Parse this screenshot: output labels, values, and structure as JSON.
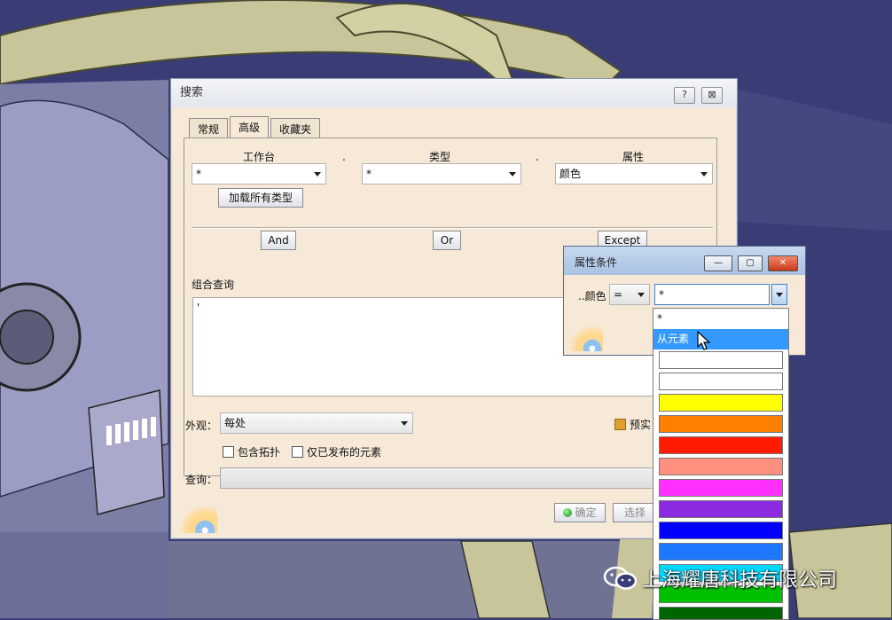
{
  "search_dialog": {
    "title": "搜索",
    "help_btn": "?",
    "close_btn": "⊠",
    "tabs": [
      {
        "label": "常规"
      },
      {
        "label": "高级"
      },
      {
        "label": "收藏夹"
      }
    ],
    "workbench": {
      "label": "工作台",
      "value": "*"
    },
    "type": {
      "label": "类型",
      "value": "*"
    },
    "attribute": {
      "label": "属性",
      "value": "颜色"
    },
    "dot": ".",
    "load_all_types": "加载所有类型",
    "and_btn": "And",
    "or_btn": "Or",
    "except_btn": "Except",
    "combined_query_label": "组合查询",
    "combined_query_text": "'",
    "appearance": {
      "label": "外观：",
      "value": "每处"
    },
    "preview": "预实",
    "include_topology": "包含拓扑",
    "only_published": "仅已发布的元素",
    "query_label": "查询：",
    "ok": "确定",
    "select": "选择"
  },
  "condition_dialog": {
    "title": "属性条件",
    "color_label": "..颜色",
    "operator": "=",
    "value": "*"
  },
  "dropdown": {
    "items": [
      "*",
      "从元素"
    ],
    "swatches": [
      "#ffffff",
      "#ffffff",
      "#ffff00",
      "#ff8000",
      "#ff1a00",
      "#ff9080",
      "#ff30ff",
      "#8a2be2",
      "#0000ff",
      "#1e78ff",
      "#00d8ff",
      "#00c000",
      "#006400"
    ]
  },
  "watermark": "上海耀唐科技有限公司"
}
